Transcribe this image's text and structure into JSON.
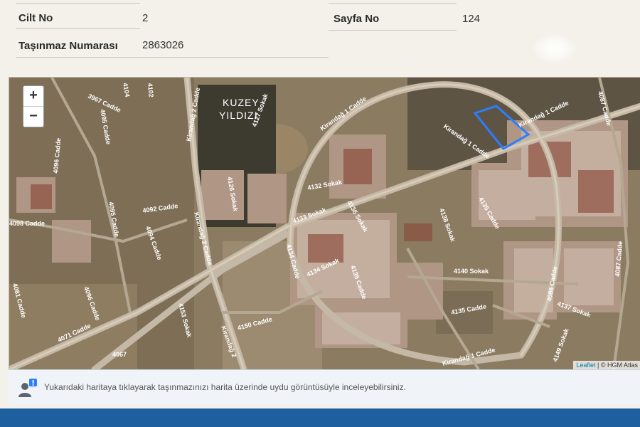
{
  "record": {
    "cilt_label": "Cilt No",
    "cilt_value": "2",
    "sayfa_label": "Sayfa No",
    "sayfa_value": "124",
    "tasinmaz_label": "Taşınmaz Numarası",
    "tasinmaz_value": "2863026"
  },
  "map": {
    "zoom_in": "+",
    "zoom_out": "−",
    "attribution_leaflet": "Leaflet",
    "attribution_rest": " | © HGM Atlas",
    "area_title_line1": "KUZEY",
    "area_title_line2": "YILDIZI",
    "parcel_color": "#2a7fff",
    "street_labels": [
      "3967 Cadde",
      "4104",
      "4102",
      "4095 Cadde",
      "4096 Cadde",
      "4095 Cadde",
      "4098 Cadde",
      "4092 Cadde",
      "4094 Cadde",
      "Kirandağ 2 Cadde",
      "4127 Sokak",
      "4126 Sokak",
      "Kirandağ 2 Cadde",
      "Kirandağ 1 Cadde",
      "4132 Sokak",
      "4133 Sokak",
      "4136 Sokak",
      "4138 Sokak",
      "4135 Cadde",
      "4134 Sokak",
      "4134 Cadde",
      "4135 Cadde",
      "4140 Sokak",
      "4135 Cadde",
      "Kirandağ 1 Cadde",
      "4150 Cadde",
      "4071 Cadde",
      "4153 Sokak",
      "4096 Cadde",
      "4081 Cadde",
      "4087 Cadde",
      "4086 Cadde",
      "4137 Sokak",
      "Kirandağ 1 Cadde",
      "4087 Cadde",
      "4149 Sokak",
      "Kirandağ 2",
      "4067",
      "Kirandağ 1 Cadde"
    ]
  },
  "info": {
    "message": "Yukarıdaki haritaya tıklayarak taşınmazınızı harita üzerinde uydu görüntüsüyle inceleyebilirsiniz."
  }
}
